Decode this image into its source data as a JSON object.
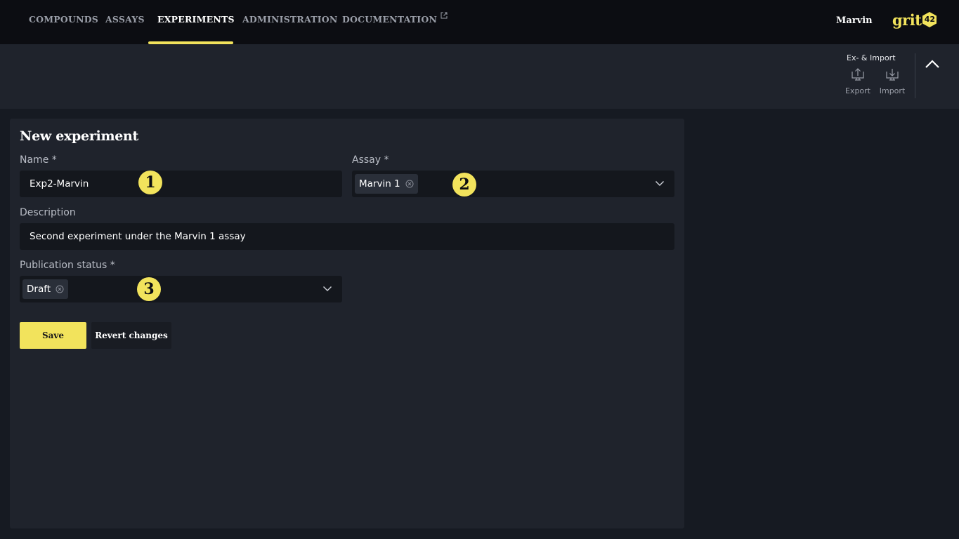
{
  "nav": {
    "items": [
      {
        "label": "COMPOUNDS"
      },
      {
        "label": "ASSAYS"
      },
      {
        "label": "EXPERIMENTS"
      },
      {
        "label": "ADMINISTRATION"
      },
      {
        "label": "DOCUMENTATION"
      }
    ],
    "active": "EXPERIMENTS",
    "user_name": "Marvin",
    "logo_text": "grit",
    "logo_badge": "42"
  },
  "toolbar": {
    "group_title": "Ex- & Import",
    "export_label": "Export",
    "import_label": "Import"
  },
  "form": {
    "title": "New experiment",
    "name_label": "Name *",
    "name_value": "Exp2-Marvin",
    "assay_label": "Assay *",
    "assay_value": "Marvin 1",
    "description_label": "Description",
    "description_value": "Second experiment under the Marvin 1 assay",
    "status_label": "Publication status *",
    "status_value": "Draft",
    "save_label": "Save",
    "revert_label": "Revert changes"
  },
  "badges": {
    "one": "1",
    "two": "2",
    "three": "3"
  },
  "colors": {
    "accent": "#f2e35c",
    "background": "#161a22",
    "card": "#1f232c",
    "topbar": "#0c0d12"
  },
  "icons": [
    "external-link-icon",
    "export-icon",
    "import-icon",
    "chevron-up-icon",
    "chevron-down-icon",
    "clear-icon"
  ]
}
